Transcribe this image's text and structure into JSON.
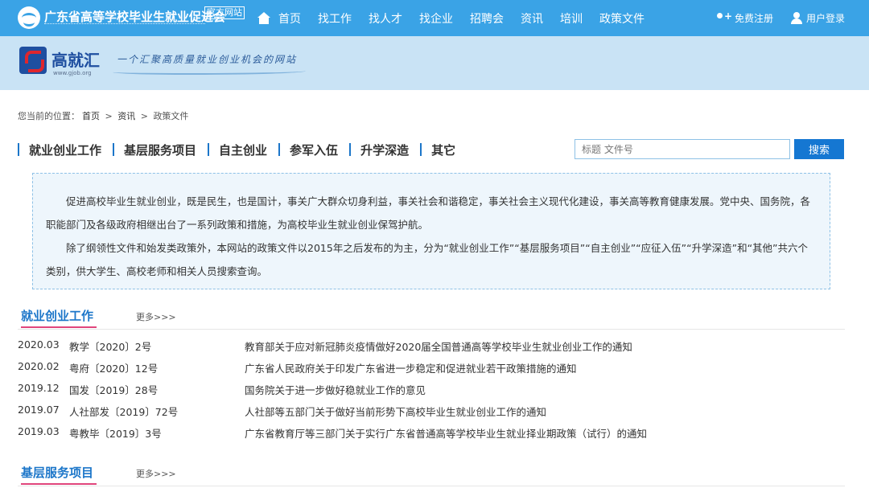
{
  "header": {
    "site_name": "广东省高等学校毕业生就业促进会",
    "official_tag": "官方网站",
    "nav": [
      "首页",
      "找工作",
      "找人才",
      "找企业",
      "招聘会",
      "资讯",
      "培训",
      "政策文件"
    ],
    "register_label": "免费注册",
    "login_label": "用户登录"
  },
  "banner": {
    "brand_name": "高就汇",
    "domain": "www.gjob.org",
    "slogan": "一个汇聚高质量就业创业机会的网站"
  },
  "breadcrumb": {
    "prefix": "您当前的位置：",
    "items": [
      "首页",
      "资讯",
      "政策文件"
    ],
    "separator": ">"
  },
  "categories": [
    "就业创业工作",
    "基层服务项目",
    "自主创业",
    "参军入伍",
    "升学深造",
    "其它"
  ],
  "search": {
    "placeholder": "标题 文件号",
    "button_label": "搜索"
  },
  "intro": {
    "para1": "促进高校毕业生就业创业，既是民生，也是国计，事关广大群众切身利益，事关社会和谐稳定，事关社会主义现代化建设，事关高等教育健康发展。党中央、国务院，各职能部门及各级政府相继出台了一系列政策和措施，为高校毕业生就业创业保驾护航。",
    "para2": "除了纲领性文件和始发类政策外，本网站的政策文件以2015年之后发布的为主，分为“就业创业工作”“基层服务项目”“自主创业”“应征入伍”“升学深造”和“其他”共六个类别，供大学生、高校老师和相关人员搜索查询。"
  },
  "sections": [
    {
      "title": "就业创业工作",
      "more": "更多>>>",
      "rows": [
        {
          "date": "2020.03",
          "doc": "教学〔2020〕2号",
          "title": "教育部关于应对新冠肺炎疫情做好2020届全国普通高等学校毕业生就业创业工作的通知"
        },
        {
          "date": "2020.02",
          "doc": "粤府〔2020〕12号",
          "title": "广东省人民政府关于印发广东省进一步稳定和促进就业若干政策措施的通知"
        },
        {
          "date": "2019.12",
          "doc": "国发〔2019〕28号",
          "title": "国务院关于进一步做好稳就业工作的意见"
        },
        {
          "date": "2019.07",
          "doc": "人社部发〔2019〕72号",
          "title": "人社部等五部门关于做好当前形势下高校毕业生就业创业工作的通知"
        },
        {
          "date": "2019.03",
          "doc": "粤教毕〔2019〕3号",
          "title": "广东省教育厅等三部门关于实行广东省普通高等学校毕业生就业择业期政策（试行）的通知"
        }
      ]
    },
    {
      "title": "基层服务项目",
      "more": "更多>>>",
      "rows": []
    }
  ]
}
